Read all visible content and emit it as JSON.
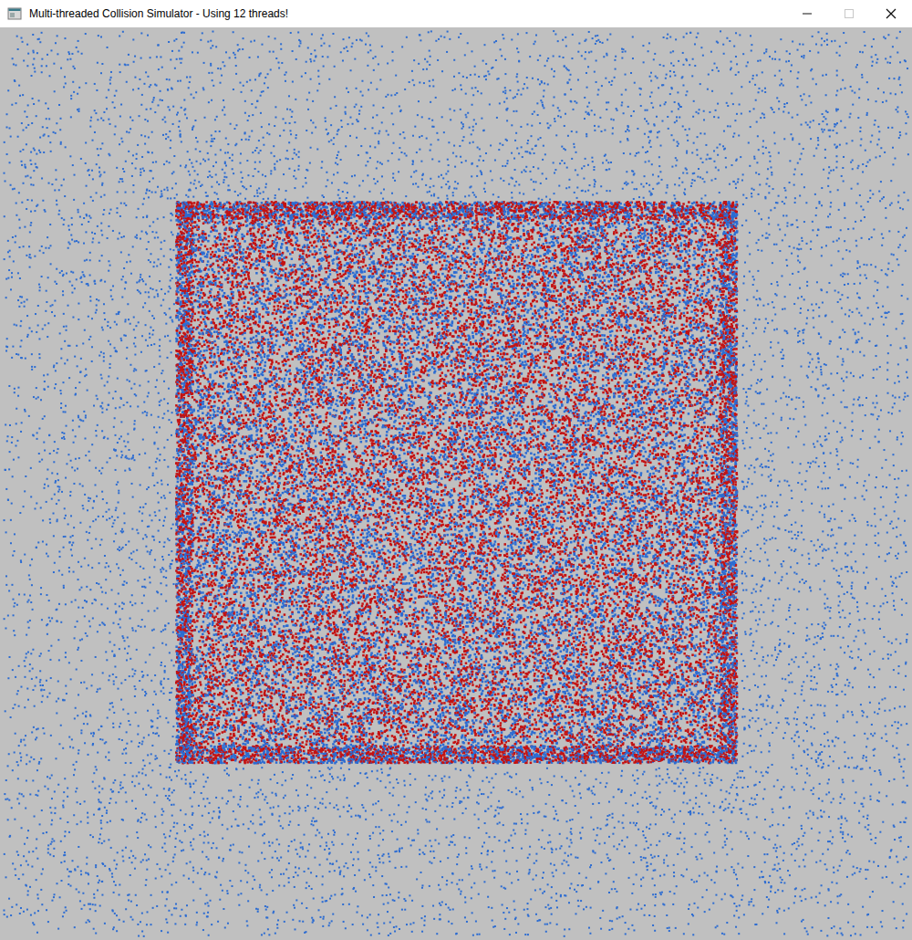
{
  "window": {
    "title": "Multi-threaded Collision Simulator - Using 12 threads!",
    "controls": [
      {
        "kind": "minimize",
        "disabled": false
      },
      {
        "kind": "maximize",
        "disabled": true
      },
      {
        "kind": "close",
        "disabled": false
      }
    ]
  },
  "simulation": {
    "background": "#c0c0c0",
    "particles": [
      {
        "kind": "square",
        "color": "#c41212",
        "count": 20000
      },
      {
        "kind": "square",
        "color": "#2c6cd2",
        "count": 20000
      },
      {
        "kind": "halo",
        "color": "#2c6cd2",
        "count": 7000
      }
    ]
  }
}
